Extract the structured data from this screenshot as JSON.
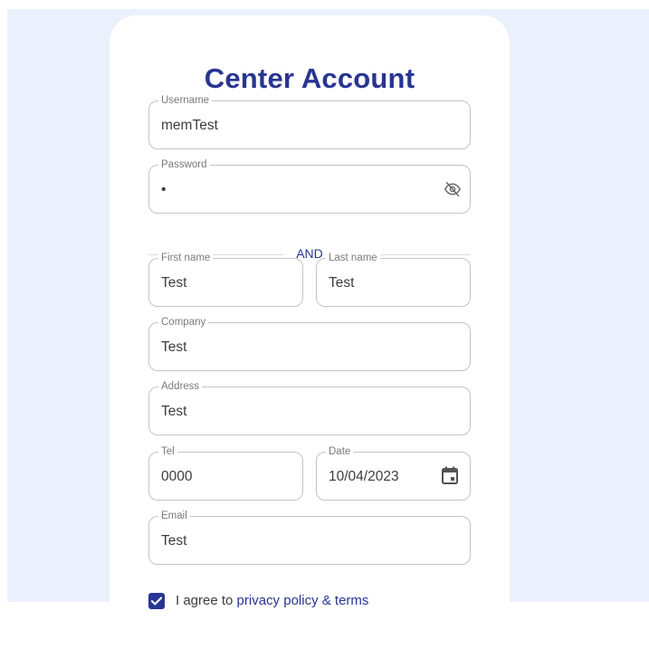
{
  "form": {
    "title": "Center Account",
    "divider_text": "AND",
    "username": {
      "label": "Username",
      "value": "memTest"
    },
    "password": {
      "label": "Password",
      "value": "•"
    },
    "first_name": {
      "label": "First name",
      "value": "Test"
    },
    "last_name": {
      "label": "Last name",
      "value": "Test"
    },
    "company": {
      "label": "Company",
      "value": "Test"
    },
    "address": {
      "label": "Address",
      "value": "Test"
    },
    "tel": {
      "label": "Tel",
      "value": "0000"
    },
    "date": {
      "label": "Date",
      "value": "10/04/2023"
    },
    "email": {
      "label": "Email",
      "value": "Test"
    },
    "agree": {
      "prefix": "I agree to ",
      "link": "privacy policy & terms",
      "checked": true
    }
  },
  "icons": {
    "password_toggle": "eye-off-icon",
    "date_picker": "calendar-icon",
    "checkbox": "check-icon"
  },
  "colors": {
    "accent": "#283593",
    "background": "#eaf1fd",
    "card": "#ffffff",
    "field_border": "#c4c4c4"
  }
}
